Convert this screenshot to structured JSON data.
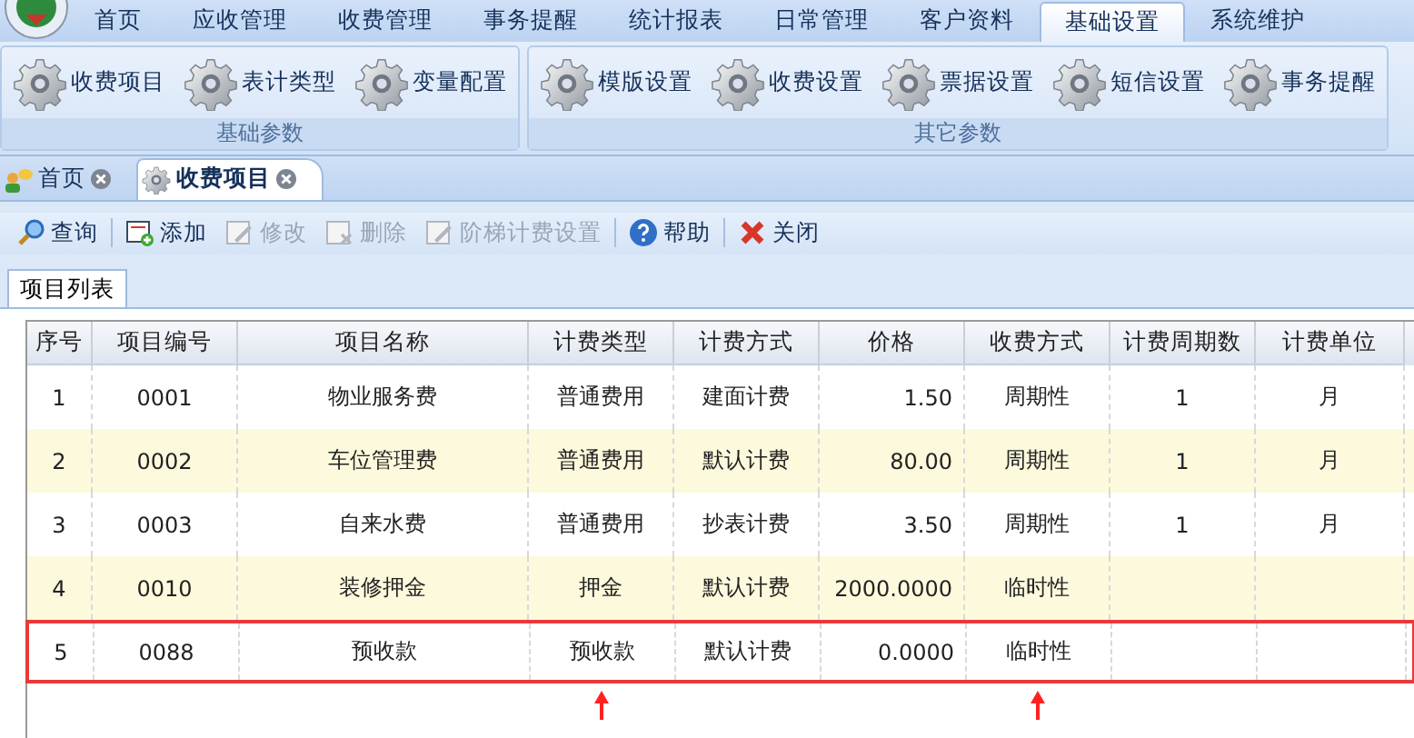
{
  "menu": [
    {
      "label": "首页",
      "selected": false
    },
    {
      "label": "应收管理",
      "selected": false
    },
    {
      "label": "收费管理",
      "selected": false
    },
    {
      "label": "事务提醒",
      "selected": false
    },
    {
      "label": "统计报表",
      "selected": false
    },
    {
      "label": "日常管理",
      "selected": false
    },
    {
      "label": "客户资料",
      "selected": false
    },
    {
      "label": "基础设置",
      "selected": true
    },
    {
      "label": "系统维护",
      "selected": false
    }
  ],
  "ribbon_groups": [
    {
      "title": "基础参数",
      "items": [
        "收费项目",
        "表计类型",
        "变量配置"
      ]
    },
    {
      "title": "其它参数",
      "items": [
        "模版设置",
        "收费设置",
        "票据设置",
        "短信设置",
        "事务提醒"
      ]
    }
  ],
  "doc_tabs": [
    {
      "label": "首页",
      "kind": "home",
      "selected": false
    },
    {
      "label": "收费项目",
      "kind": "gear",
      "selected": true
    }
  ],
  "toolbar": [
    {
      "label": "查询",
      "kind": "search",
      "disabled": false
    },
    {
      "label": "添加",
      "kind": "add",
      "disabled": false
    },
    {
      "label": "修改",
      "kind": "edit",
      "disabled": true
    },
    {
      "label": "删除",
      "kind": "delete",
      "disabled": true
    },
    {
      "label": "阶梯计费设置",
      "kind": "edit",
      "disabled": true
    },
    {
      "label": "帮助",
      "kind": "help",
      "disabled": false
    },
    {
      "label": "关闭",
      "kind": "close",
      "disabled": false
    }
  ],
  "panel_tab": "项目列表",
  "table": {
    "columns": [
      {
        "label": "序号",
        "kind": "text",
        "arrow": false
      },
      {
        "label": "项目编号",
        "kind": "text",
        "arrow": false
      },
      {
        "label": "项目名称",
        "kind": "text",
        "arrow": false
      },
      {
        "label": "计费类型",
        "kind": "text",
        "arrow": true
      },
      {
        "label": "计费方式",
        "kind": "text",
        "arrow": false
      },
      {
        "label": "价格",
        "kind": "number",
        "arrow": false
      },
      {
        "label": "收费方式",
        "kind": "text",
        "arrow": true
      },
      {
        "label": "计费周期数",
        "kind": "text",
        "arrow": false
      },
      {
        "label": "计费单位",
        "kind": "text",
        "arrow": false
      }
    ],
    "rows": [
      {
        "cells": [
          "1",
          "0001",
          "物业服务费",
          "普通费用",
          "建面计费",
          "1.50",
          "周期性",
          "1",
          "月"
        ],
        "highlighted": false
      },
      {
        "cells": [
          "2",
          "0002",
          "车位管理费",
          "普通费用",
          "默认计费",
          "80.00",
          "周期性",
          "1",
          "月"
        ],
        "highlighted": false
      },
      {
        "cells": [
          "3",
          "0003",
          "自来水费",
          "普通费用",
          "抄表计费",
          "3.50",
          "周期性",
          "1",
          "月"
        ],
        "highlighted": false
      },
      {
        "cells": [
          "4",
          "0010",
          "装修押金",
          "押金",
          "默认计费",
          "2000.0000",
          "临时性",
          "",
          ""
        ],
        "highlighted": false
      },
      {
        "cells": [
          "5",
          "0088",
          "预收款",
          "预收款",
          "默认计费",
          "0.0000",
          "临时性",
          "",
          ""
        ],
        "highlighted": true
      }
    ]
  }
}
